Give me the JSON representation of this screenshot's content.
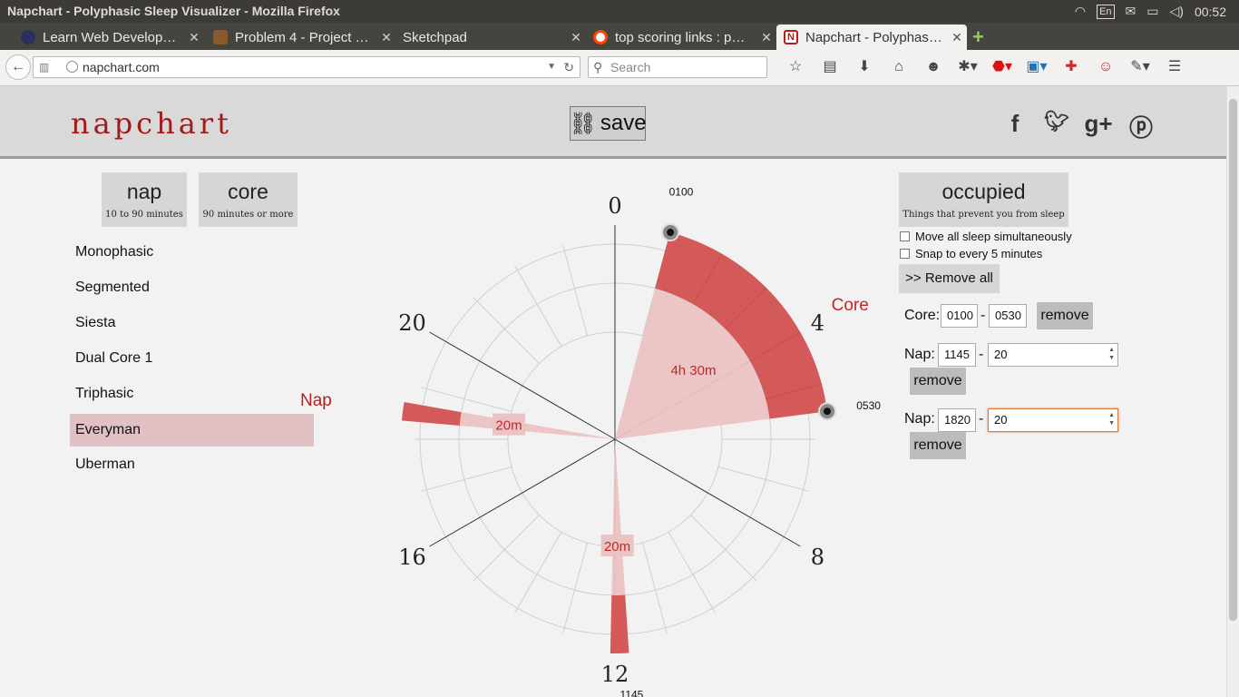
{
  "os": {
    "window_title": "Napchart - Polyphasic Sleep Visualizer - Mozilla Firefox",
    "language": "En",
    "clock": "00:52"
  },
  "tabs": [
    {
      "label": "Learn Web Develop…",
      "icon": "mdn-icon",
      "color": "#2b2f5f"
    },
    {
      "label": "Problem 4 - Project …",
      "icon": "project-euler-icon",
      "color": "#8a5a2a"
    },
    {
      "label": "Sketchpad",
      "icon": "blank-icon",
      "color": "#45443f"
    },
    {
      "label": "top scoring links : p…",
      "icon": "reddit-icon",
      "color": "#ff4500"
    },
    {
      "label": "Napchart - Polyphas…",
      "icon": "napchart-icon",
      "color": "#b51e1e"
    }
  ],
  "navbar": {
    "url": "napchart.com",
    "search_placeholder": "Search"
  },
  "header": {
    "logo": "napchart",
    "save_label": "save"
  },
  "blocks": {
    "nap": {
      "title": "nap",
      "subtitle": "10 to 90 minutes"
    },
    "core": {
      "title": "core",
      "subtitle": "90 minutes or more"
    },
    "occupied": {
      "title": "occupied",
      "subtitle": "Things that prevent you from sleep"
    }
  },
  "presets": [
    "Monophasic",
    "Segmented",
    "Siesta",
    "Dual Core 1",
    "Triphasic",
    "Everyman",
    "Uberman"
  ],
  "selected_preset": "Everyman",
  "options": {
    "move_all": "Move all sleep simultaneously",
    "snap": "Snap to every 5 minutes",
    "remove_all": ">> Remove all"
  },
  "schedule": {
    "core": {
      "label": "Core:",
      "start": "0100",
      "end": "0530",
      "remove": "remove"
    },
    "nap1": {
      "label": "Nap:",
      "start": "1145",
      "duration": "20",
      "remove": "remove"
    },
    "nap2": {
      "label": "Nap:",
      "start": "1820",
      "duration": "20",
      "remove": "remove"
    }
  },
  "chart_data": {
    "type": "polar-clock",
    "hour_labels": [
      "0",
      "4",
      "8",
      "12",
      "16",
      "20"
    ],
    "segments": [
      {
        "name": "Core",
        "start": "0100",
        "end": "0530",
        "duration_label": "4h 30m"
      },
      {
        "name": "Nap",
        "start": "1145",
        "end": "1205",
        "duration_label": "20m"
      },
      {
        "name": "Nap",
        "start": "1820",
        "end": "1840",
        "duration_label": "20m"
      }
    ],
    "edge_labels": [
      "0100",
      "0530",
      "1145",
      "1820"
    ],
    "legend": {
      "core": "Core",
      "nap": "Nap"
    },
    "colors": {
      "dark": "#d45a5a",
      "light": "#ebc3c3",
      "label": "#c0282a"
    }
  }
}
